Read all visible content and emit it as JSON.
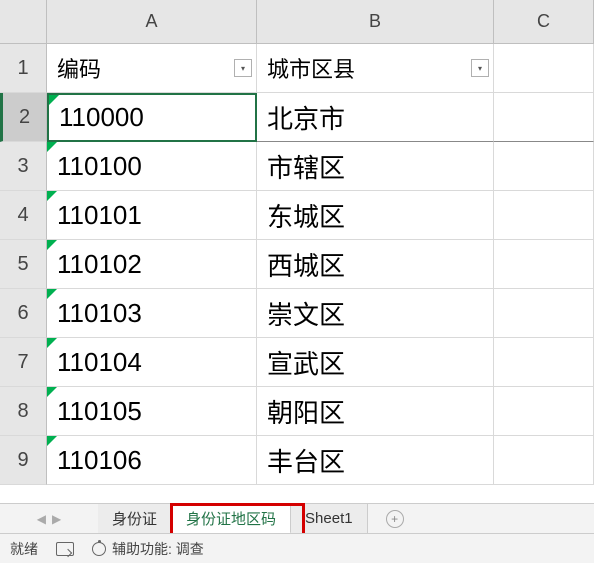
{
  "columns": {
    "A": "A",
    "B": "B",
    "C": "C"
  },
  "rows": [
    "1",
    "2",
    "3",
    "4",
    "5",
    "6",
    "7",
    "8",
    "9"
  ],
  "headers": {
    "code": "编码",
    "city": "城市区县"
  },
  "data": [
    {
      "code": "110000",
      "city": "北京市"
    },
    {
      "code": "110100",
      "city": "市辖区"
    },
    {
      "code": "110101",
      "city": "东城区"
    },
    {
      "code": "110102",
      "city": "西城区"
    },
    {
      "code": "110103",
      "city": "崇文区"
    },
    {
      "code": "110104",
      "city": "宣武区"
    },
    {
      "code": "110105",
      "city": "朝阳区"
    },
    {
      "code": "110106",
      "city": "丰台区"
    }
  ],
  "tabs": {
    "t1": "身份证",
    "t2": "身份证地区码",
    "t3": "Sheet1"
  },
  "status": {
    "ready": "就绪",
    "a11y": "辅助功能: 调查"
  },
  "selected_row": 2,
  "chart_data": {
    "type": "table",
    "columns": [
      "编码",
      "城市区县"
    ],
    "rows": [
      [
        "110000",
        "北京市"
      ],
      [
        "110100",
        "市辖区"
      ],
      [
        "110101",
        "东城区"
      ],
      [
        "110102",
        "西城区"
      ],
      [
        "110103",
        "崇文区"
      ],
      [
        "110104",
        "宣武区"
      ],
      [
        "110105",
        "朝阳区"
      ],
      [
        "110106",
        "丰台区"
      ]
    ]
  }
}
